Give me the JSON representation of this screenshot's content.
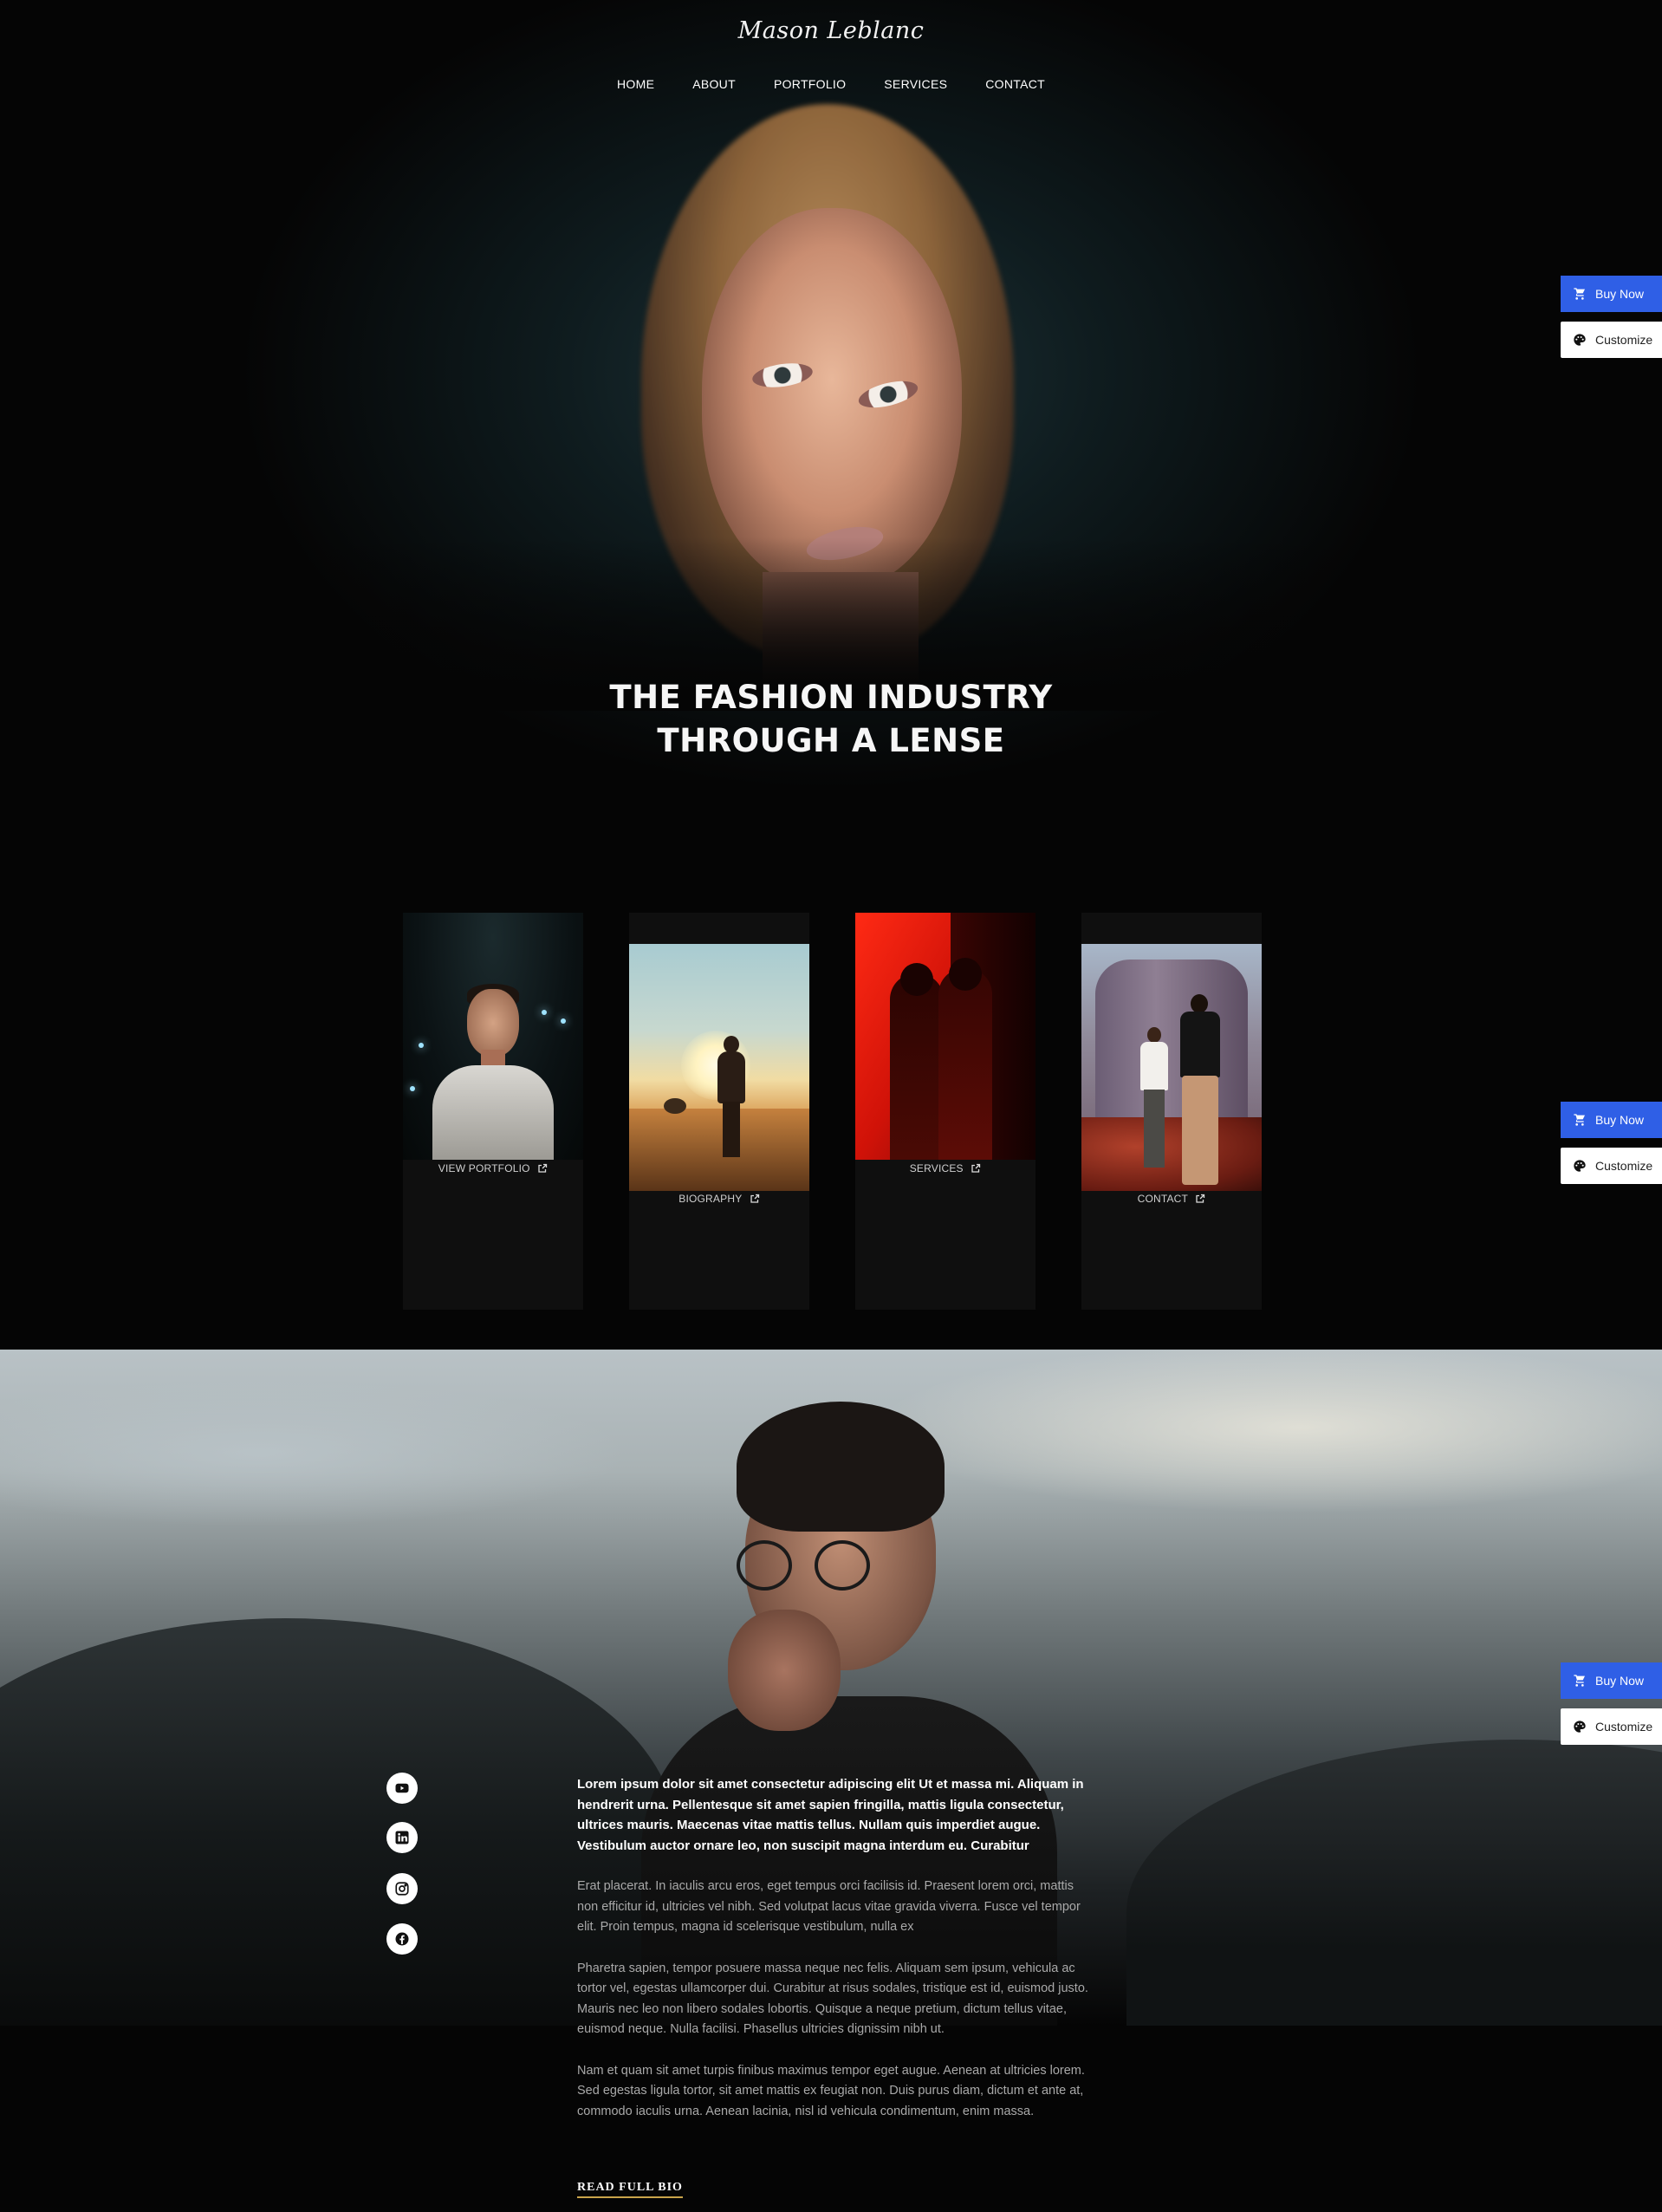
{
  "brand": {
    "logo": "Mason Leblanc"
  },
  "nav": {
    "items": [
      "HOME",
      "ABOUT",
      "PORTFOLIO",
      "SERVICES",
      "CONTACT"
    ]
  },
  "hero": {
    "title_line1": "THE FASHION INDUSTRY",
    "title_line2": "THROUGH A LENSE"
  },
  "cards": [
    {
      "label": "VIEW PORTFOLIO"
    },
    {
      "label": "BIOGRAPHY"
    },
    {
      "label": "SERVICES"
    },
    {
      "label": "CONTACT"
    }
  ],
  "socials": [
    "youtube-icon",
    "linkedin-icon",
    "instagram-icon",
    "facebook-icon"
  ],
  "bio": {
    "lead": "Lorem ipsum dolor sit amet consectetur adipiscing elit Ut et massa mi. Aliquam in hendrerit urna. Pellentesque sit amet sapien fringilla, mattis ligula consectetur, ultrices mauris. Maecenas vitae mattis tellus. Nullam quis imperdiet augue. Vestibulum auctor ornare leo, non suscipit magna interdum eu. Curabitur",
    "paragraphs": [
      "Erat placerat. In iaculis arcu eros, eget tempus orci facilisis id. Praesent lorem orci, mattis non efficitur id, ultricies vel nibh. Sed volutpat lacus vitae gravida viverra. Fusce vel tempor elit. Proin tempus, magna id scelerisque vestibulum, nulla ex",
      "Pharetra sapien, tempor posuere massa neque nec felis. Aliquam sem ipsum, vehicula ac tortor vel, egestas ullamcorper dui. Curabitur at risus sodales, tristique est id, euismod justo. Mauris nec leo non libero sodales lobortis. Quisque a neque pretium, dictum tellus vitae, euismod neque. Nulla facilisi. Phasellus ultricies dignissim nibh ut.",
      "Nam et quam sit amet turpis finibus maximus tempor eget augue. Aenean at ultricies lorem. Sed egestas ligula tortor, sit amet mattis ex feugiat non. Duis purus diam, dictum et ante at, commodo iaculis urna. Aenean lacinia, nisl id vehicula condimentum, enim massa."
    ],
    "read_more": "READ FULL BIO"
  },
  "floating": {
    "buy_label": "Buy Now",
    "customize_label": "Customize"
  },
  "colors": {
    "accent": "#2f5fe6",
    "underline": "#c9a44a",
    "background": "#050505"
  }
}
